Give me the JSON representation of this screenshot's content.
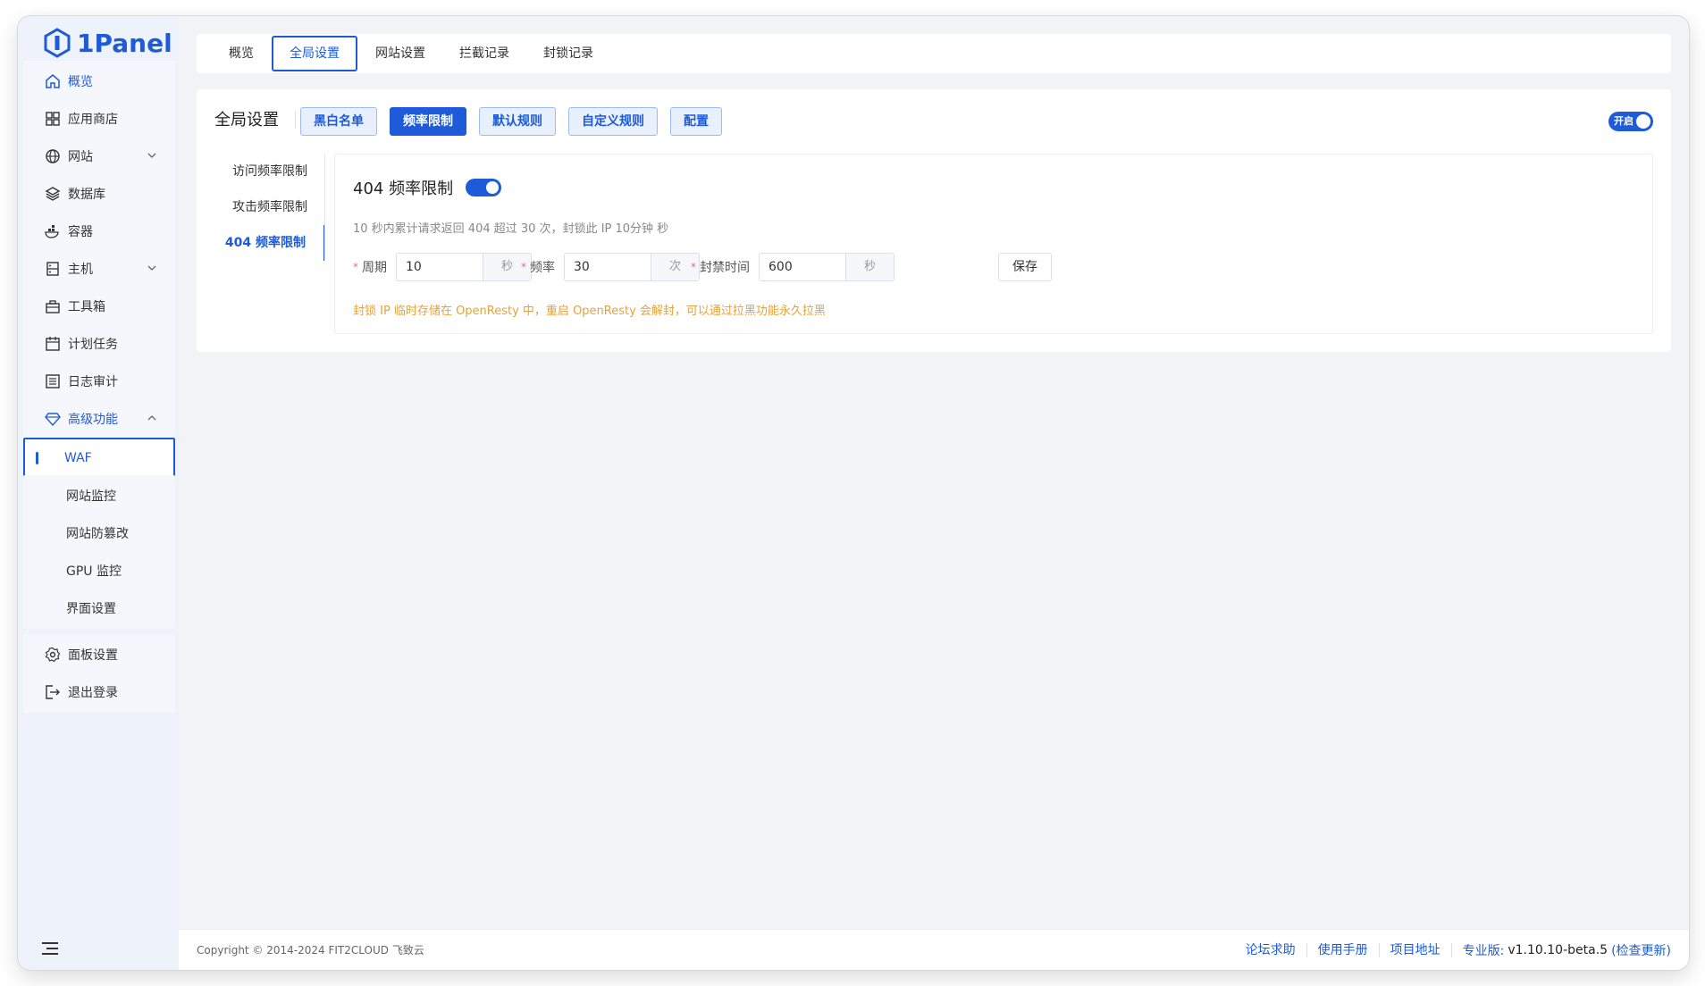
{
  "brand": {
    "name": "1Panel"
  },
  "sidebar": {
    "items": [
      {
        "label": "概览",
        "icon": "home-icon"
      },
      {
        "label": "应用商店",
        "icon": "grid-icon"
      },
      {
        "label": "网站",
        "icon": "globe-icon"
      },
      {
        "label": "数据库",
        "icon": "layers-icon"
      },
      {
        "label": "容器",
        "icon": "docker-icon"
      },
      {
        "label": "主机",
        "icon": "server-icon"
      },
      {
        "label": "工具箱",
        "icon": "toolbox-icon"
      },
      {
        "label": "计划任务",
        "icon": "calendar-icon"
      },
      {
        "label": "日志审计",
        "icon": "list-icon"
      },
      {
        "label": "高级功能",
        "icon": "diamond-icon"
      },
      {
        "label": "WAF"
      },
      {
        "label": "网站监控"
      },
      {
        "label": "网站防篡改"
      },
      {
        "label": "GPU 监控"
      },
      {
        "label": "界面设置"
      },
      {
        "label": "面板设置",
        "icon": "gear-icon"
      },
      {
        "label": "退出登录",
        "icon": "logout-icon"
      }
    ]
  },
  "top_tabs": [
    "概览",
    "全局设置",
    "网站设置",
    "拦截记录",
    "封锁记录"
  ],
  "main": {
    "title": "全局设置",
    "subtabs": [
      "黑白名单",
      "频率限制",
      "默认规则",
      "自定义规则",
      "配置"
    ],
    "global_toggle_label": "开启",
    "left_nav": [
      "访问频率限制",
      "攻击频率限制",
      "404 频率限制"
    ],
    "panel": {
      "title": "404 频率限制",
      "description": "10 秒内累计请求返回 404 超过 30 次，封锁此 IP 10分钟 秒",
      "fields": [
        {
          "label": "周期",
          "value": "10",
          "suffix": "秒"
        },
        {
          "label": "频率",
          "value": "30",
          "suffix": "次"
        },
        {
          "label": "封禁时间",
          "value": "600",
          "suffix": "秒"
        }
      ],
      "save_label": "保存",
      "warning": "封锁 IP 临时存储在 OpenResty 中，重启 OpenResty 会解封，可以通过拉黑功能永久拉黑"
    }
  },
  "footer": {
    "copyright": "Copyright © 2014-2024 FIT2CLOUD 飞致云",
    "links": [
      "论坛求助",
      "使用手册",
      "项目地址"
    ],
    "edition": "专业版:",
    "version": "v1.10.10-beta.5",
    "check_update": "(检查更新)"
  },
  "colors": {
    "accent": "#1e5bd8",
    "warning": "#e6a23c"
  }
}
